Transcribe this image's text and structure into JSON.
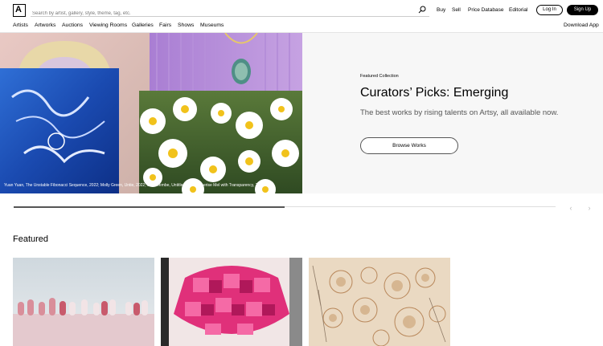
{
  "header": {
    "logo_letter": "A",
    "search_placeholder": "Search by artist, gallery, style, theme, tag, etc.",
    "links": [
      "Buy",
      "Sell",
      "Price Database",
      "Editorial"
    ],
    "login_label": "Log In",
    "signup_label": "Sign Up"
  },
  "nav": {
    "items": [
      "Artists",
      "Artworks",
      "Auctions",
      "Viewing Rooms",
      "Galleries",
      "Fairs",
      "Shows",
      "Museums"
    ],
    "download": "Download App"
  },
  "hero": {
    "eyebrow": "Featured Collection",
    "title": "Curators’ Picks: Emerging",
    "description": "The best works by rising talents on Artsy, all available now.",
    "button_label": "Browse Works",
    "caption": "Yuan Yuan, The Unstable Fibonacci Sequence, 2022; Molly Green, Untie, 2022; Lebo Tembe, Untitled, 2022; Sherise Mel with Transparency, 2022.",
    "progress": 0.5
  },
  "carousel": {
    "prev": "‹",
    "next": "›"
  },
  "featured": {
    "heading": "Featured"
  },
  "icons": [
    "search-icon",
    "chevron-left-icon",
    "chevron-right-icon"
  ]
}
